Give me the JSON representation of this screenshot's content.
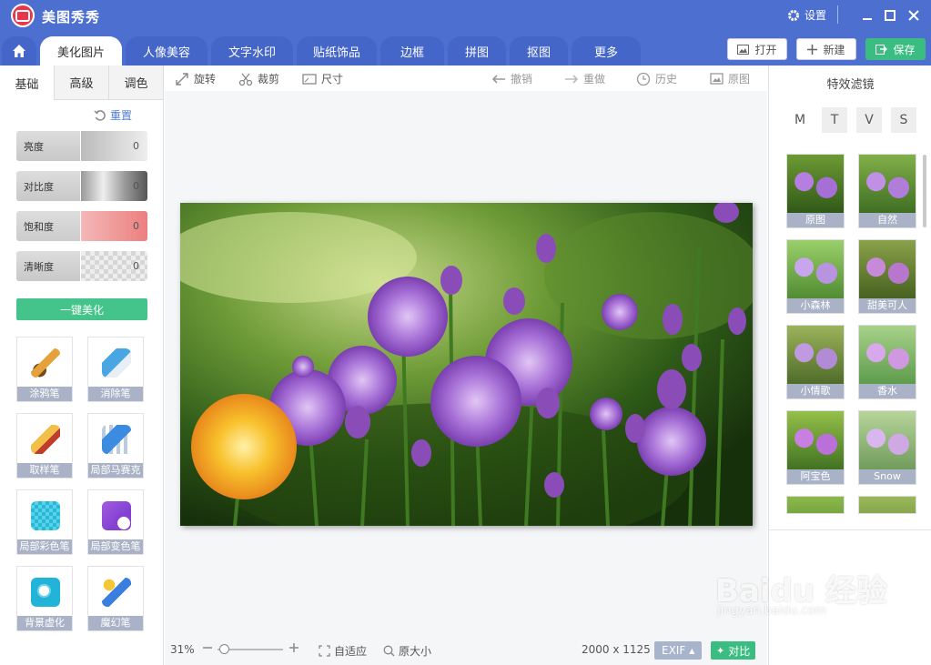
{
  "app": {
    "title": "美图秀秀",
    "settings_label": "设置"
  },
  "tabs": [
    {
      "label": "美化图片"
    },
    {
      "label": "人像美容"
    },
    {
      "label": "文字水印"
    },
    {
      "label": "贴纸饰品"
    },
    {
      "label": "边框"
    },
    {
      "label": "拼图"
    },
    {
      "label": "抠图"
    },
    {
      "label": "更多"
    }
  ],
  "header_buttons": {
    "open": "打开",
    "new": "新建",
    "save": "保存"
  },
  "left_tabs": [
    {
      "label": "基础"
    },
    {
      "label": "高级"
    },
    {
      "label": "调色"
    }
  ],
  "reset_label": "重置",
  "sliders": [
    {
      "label": "亮度",
      "value": "0"
    },
    {
      "label": "对比度",
      "value": "0"
    },
    {
      "label": "饱和度",
      "value": "0"
    },
    {
      "label": "清晰度",
      "value": "0"
    }
  ],
  "one_click_label": "一键美化",
  "tools": [
    {
      "label": "涂鸦笔"
    },
    {
      "label": "消除笔"
    },
    {
      "label": "取样笔"
    },
    {
      "label": "局部马赛克"
    },
    {
      "label": "局部彩色笔"
    },
    {
      "label": "局部变色笔"
    },
    {
      "label": "背景虚化"
    },
    {
      "label": "魔幻笔"
    }
  ],
  "toolbar": {
    "rotate": "旋转",
    "crop": "裁剪",
    "size": "尺寸",
    "undo": "撤销",
    "redo": "重做",
    "history": "历史",
    "original": "原图"
  },
  "status": {
    "zoom": "31%",
    "fit": "自适应",
    "actual_size": "原大小",
    "dimensions": "2000 x 1125",
    "exif": "EXIF",
    "compare": "对比"
  },
  "filters": {
    "title": "特效滤镜",
    "tabs": [
      "M",
      "T",
      "V",
      "S"
    ],
    "items": [
      {
        "label": "原图"
      },
      {
        "label": "自然"
      },
      {
        "label": "小森林"
      },
      {
        "label": "甜美可人"
      },
      {
        "label": "小情歌"
      },
      {
        "label": "香水"
      },
      {
        "label": "阿宝色"
      },
      {
        "label": "Snow"
      }
    ]
  },
  "watermark": {
    "text": "Baidu 经验",
    "sub": "jingyan.baidu.com"
  }
}
